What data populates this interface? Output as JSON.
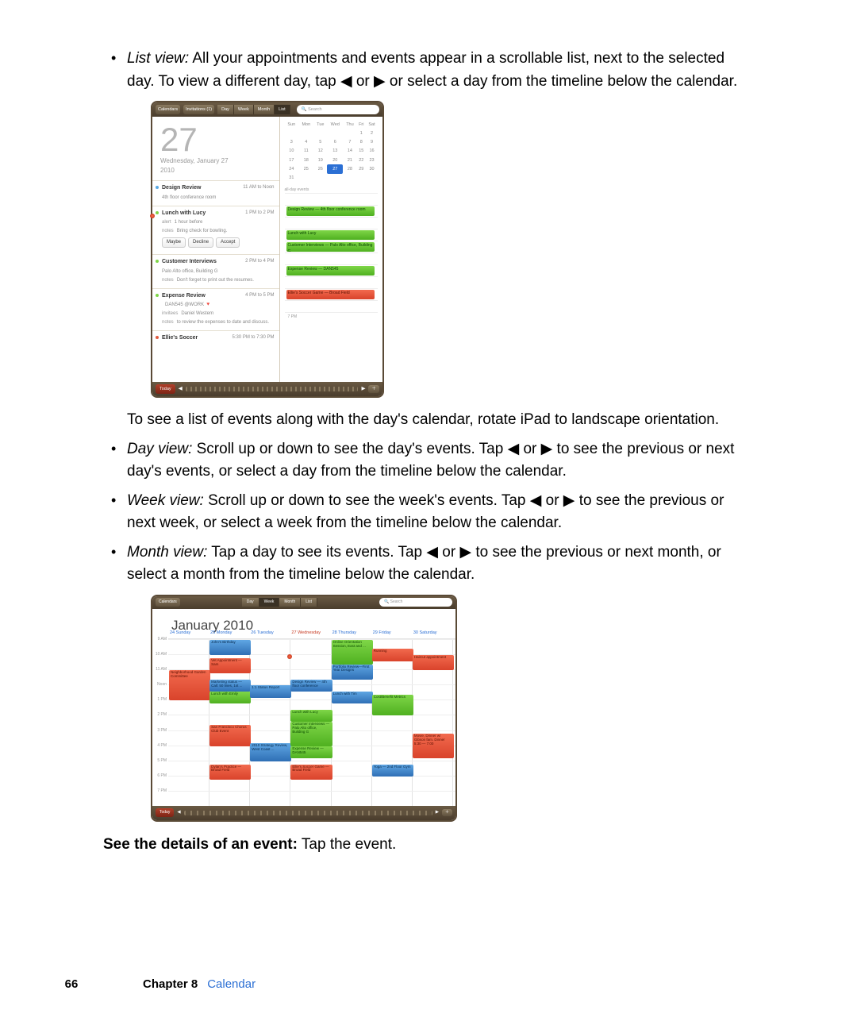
{
  "bullets": {
    "list_view_label": "List view:",
    "list_view_text": " All your appointments and events appear in a scrollable list, next to the selected day. To view a different day, tap ◀ or ▶ or select a day from the timeline below the calendar.",
    "after_fig1": "To see a list of events along with the day's calendar, rotate iPad to landscape orientation.",
    "day_view_label": "Day view:",
    "day_view_text": " Scroll up or down to see the day's events. Tap ◀ or ▶ to see the previous or next day's events, or select a day from the timeline below the calendar.",
    "week_view_label": "Week view:",
    "week_view_text": " Scroll up or down to see the week's events. Tap ◀ or ▶ to see the previous or next week, or select a week from the timeline below the calendar.",
    "month_view_label": "Month view:",
    "month_view_text": " Tap a day to see its events. Tap ◀ or ▶ to see the previous or next month, or select a month from the timeline below the calendar."
  },
  "see_details_bold": "See the details of an event:",
  "see_details_rest": " Tap the event.",
  "footer": {
    "page": "66",
    "chapter": "Chapter 8",
    "section": "Calendar"
  },
  "fig1": {
    "toolbar": {
      "calendars": "Calendars",
      "invitations": "Invitations (1)",
      "today": "Today"
    },
    "segments": [
      "Day",
      "Week",
      "Month",
      "List"
    ],
    "active_segment": "List",
    "search_placeholder": "Search",
    "date_big": "27",
    "date_line": "Wednesday, January 27",
    "date_year": "2010",
    "minical_headers": [
      "Sun",
      "Mon",
      "Tue",
      "Wed",
      "Thu",
      "Fri",
      "Sat"
    ],
    "minical_rows": [
      [
        "",
        "",
        "",
        "",
        "",
        "1",
        "2"
      ],
      [
        "3",
        "4",
        "5",
        "6",
        "7",
        "8",
        "9"
      ],
      [
        "10",
        "11",
        "12",
        "13",
        "14",
        "15",
        "16"
      ],
      [
        "17",
        "18",
        "19",
        "20",
        "21",
        "22",
        "23"
      ],
      [
        "24",
        "25",
        "26",
        "27",
        "28",
        "29",
        "30"
      ],
      [
        "31",
        "",
        "",
        "",
        "",
        "",
        ""
      ]
    ],
    "minical_today": "27",
    "allday_label": "all-day events",
    "events": [
      {
        "dot": "#5aa9e3",
        "title": "Design Review",
        "sub": "4th floor conference room",
        "time": "11 AM to Noon"
      },
      {
        "dot": "#7fd648",
        "title": "Lunch with Lucy",
        "time": "1 PM to 2 PM",
        "lines": [
          {
            "lbl": "alert",
            "val": "1 hour before"
          },
          {
            "lbl": "notes",
            "val": "Bring check for bowling."
          }
        ],
        "buttons": [
          "Maybe",
          "Decline",
          "Accept"
        ]
      },
      {
        "dot": "#7fd648",
        "title": "Customer Interviews",
        "sub": "Palo Alto office, Building G",
        "time": "2 PM to 4 PM",
        "lines": [
          {
            "lbl": "notes",
            "val": "Don't forget to print out the resumes."
          }
        ]
      },
      {
        "dot": "#7fd648",
        "title": "Expense Review",
        "time": "4 PM to 5 PM",
        "lines": [
          {
            "lbl": "",
            "val": "DAN545 @WORK 🔻"
          },
          {
            "lbl": "invitees",
            "val": "Daniel Western"
          },
          {
            "lbl": "notes",
            "val": "to review the expenses to date and discuss."
          }
        ]
      },
      {
        "dot": "#e25b3f",
        "title": "Ellie's Soccer",
        "sub": "",
        "time": "5:30 PM to 7:30 PM"
      }
    ],
    "schedule": [
      {
        "type": "label",
        "text": ""
      },
      {
        "type": "green",
        "text": "Design Review — 4th floor conference room"
      },
      {
        "type": "blank"
      },
      {
        "type": "green",
        "text": "Lunch with Lucy"
      },
      {
        "type": "green",
        "text": "Customer Interviews — Palo Alto office, Building G"
      },
      {
        "type": "blank"
      },
      {
        "type": "green",
        "text": "Expense Review — DAN545"
      },
      {
        "type": "blank"
      },
      {
        "type": "red",
        "text": "Ellie's Soccer Game — Broad Field"
      },
      {
        "type": "blank"
      },
      {
        "type": "blank",
        "label": "7 PM"
      }
    ]
  },
  "fig2": {
    "toolbar": {
      "calendars": "Calendars",
      "today": "Today"
    },
    "segments": [
      "Day",
      "Week",
      "Month",
      "List"
    ],
    "active_segment": "Week",
    "search_placeholder": "Search",
    "month_title": "January 2010",
    "day_headers": [
      "24 Sunday",
      "25 Monday",
      "26 Tuesday",
      "27 Wednesday",
      "28 Thursday",
      "29 Friday",
      "30 Saturday"
    ],
    "active_day_index": 3,
    "hours": [
      "9 AM",
      "10 AM",
      "11 AM",
      "Noon",
      "1 PM",
      "2 PM",
      "3 PM",
      "4 PM",
      "5 PM",
      "6 PM",
      "7 PM"
    ],
    "events": [
      {
        "c": 1,
        "r": 0,
        "h": 1,
        "cls": "b",
        "t": "John's Birthday"
      },
      {
        "c": 0,
        "r": 2,
        "h": 2,
        "cls": "r",
        "t": "Neighborhood Garden Committee"
      },
      {
        "c": 1,
        "r": 1.2,
        "h": 1,
        "cls": "r",
        "t": "Vet Appointment — Sam"
      },
      {
        "c": 1,
        "r": 2.6,
        "h": 0.8,
        "cls": "b",
        "t": "Marketing status — Call: 50 lines, 1st ..."
      },
      {
        "c": 1,
        "r": 3.4,
        "h": 0.8,
        "cls": "g",
        "t": "Lunch with Emily"
      },
      {
        "c": 1,
        "r": 5.6,
        "h": 1.4,
        "cls": "r",
        "t": "San Francisco Chorus Club Event"
      },
      {
        "c": 1,
        "r": 8.2,
        "h": 1,
        "cls": "r",
        "t": "Dylan's Practice — Broad Field"
      },
      {
        "c": 2,
        "r": 3,
        "h": 0.8,
        "cls": "b",
        "t": "1:1 Status Report"
      },
      {
        "c": 2,
        "r": 6.8,
        "h": 1.2,
        "cls": "b",
        "t": "2010 Strategy Review, West Coast ..."
      },
      {
        "c": 3,
        "r": 2.6,
        "h": 0.8,
        "cls": "b",
        "t": "Design Review — 4th floor conference"
      },
      {
        "c": 3,
        "r": 4.6,
        "h": 0.8,
        "cls": "g",
        "t": "Lunch with Lucy"
      },
      {
        "c": 3,
        "r": 5.4,
        "h": 1.6,
        "cls": "g",
        "t": "Customer Interviews — Palo Alto office, Building G"
      },
      {
        "c": 3,
        "r": 7,
        "h": 0.8,
        "cls": "g",
        "t": "Expense Review — DAN545"
      },
      {
        "c": 3,
        "r": 8.2,
        "h": 1,
        "cls": "r",
        "t": "Ellie's Soccer Game — Broad Field"
      },
      {
        "c": 4,
        "r": 0,
        "h": 1.6,
        "cls": "g",
        "t": "Online Orientation Session, East and ..."
      },
      {
        "c": 4,
        "r": 1.6,
        "h": 1,
        "cls": "b",
        "t": "Portfolio Review—First Year Designs"
      },
      {
        "c": 4,
        "r": 3.4,
        "h": 0.8,
        "cls": "b",
        "t": "Lunch with Tim"
      },
      {
        "c": 5,
        "r": 0.6,
        "h": 0.8,
        "cls": "r",
        "t": "Running"
      },
      {
        "c": 5,
        "r": 3.6,
        "h": 1.4,
        "cls": "g",
        "t": "Cost/Benefit Metrics"
      },
      {
        "c": 5,
        "r": 8.2,
        "h": 0.8,
        "cls": "b",
        "t": "Yoga — 2nd Floor Gym"
      },
      {
        "c": 6,
        "r": 1,
        "h": 1,
        "cls": "r",
        "t": "Haircut appointment"
      },
      {
        "c": 6,
        "r": 6.2,
        "h": 1.6,
        "cls": "r",
        "t": "Movie, Dinner w/ Gibson fam. Dinner 5:30 — 7:00"
      }
    ]
  }
}
